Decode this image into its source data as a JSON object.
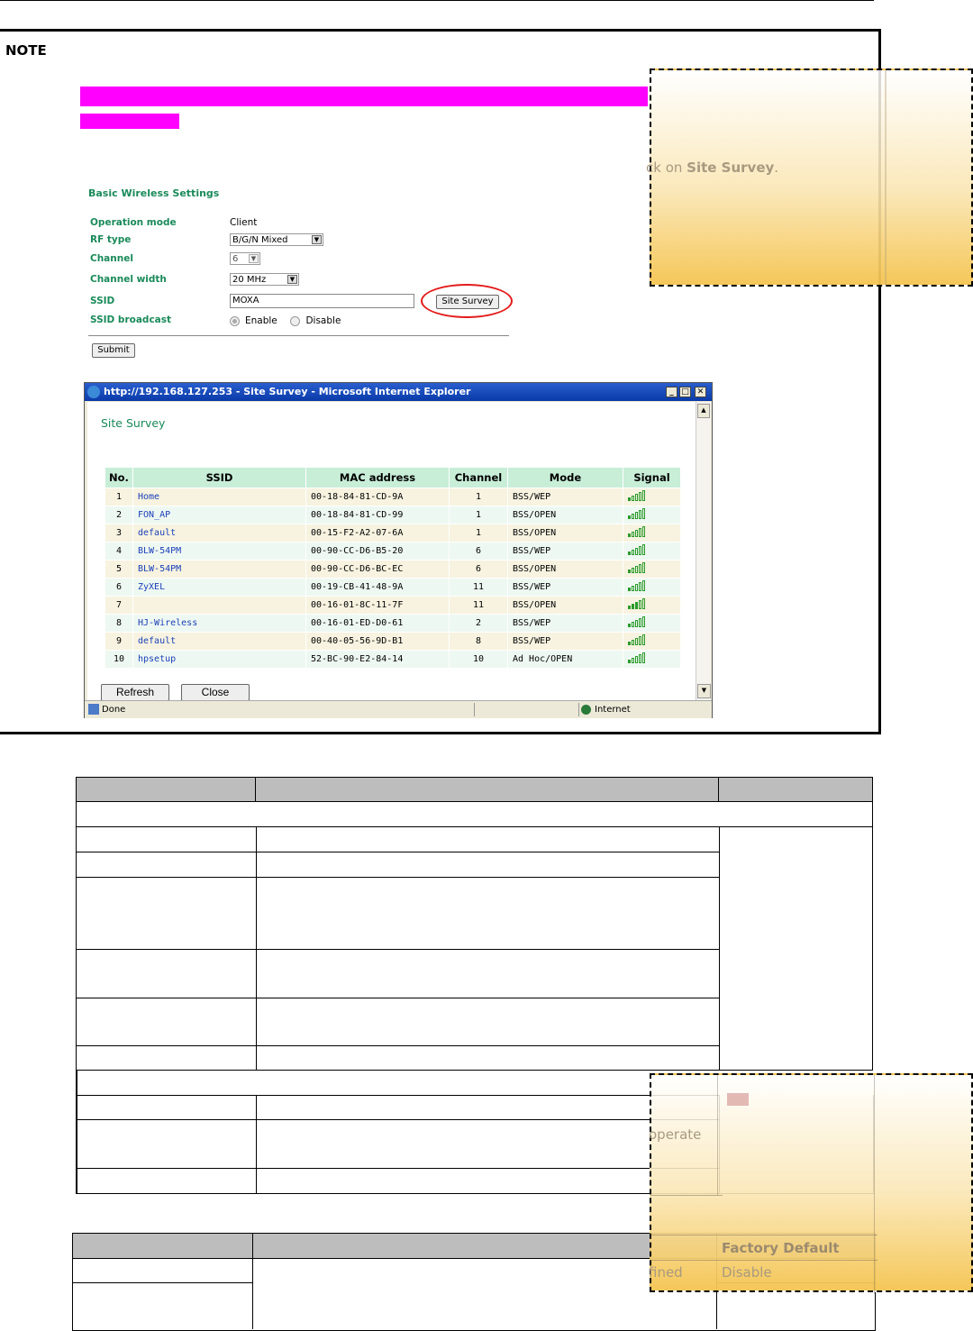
{
  "note": {
    "label": "NOTE"
  },
  "callout_top": {
    "text_prefix": "ck on ",
    "text_bold": "Site Survey",
    "text_suffix": "."
  },
  "basic_wireless": {
    "title": "Basic Wireless Settings",
    "rows": [
      {
        "label": "Operation mode",
        "value": "Client"
      },
      {
        "label": "RF type",
        "value": "B/G/N Mixed"
      },
      {
        "label": "Channel",
        "value": "6"
      },
      {
        "label": "Channel width",
        "value": "20 MHz"
      },
      {
        "label": "SSID",
        "value": "MOXA"
      },
      {
        "label": "SSID broadcast",
        "value": ""
      }
    ],
    "site_survey_button": "Site Survey",
    "radio_enable": "Enable",
    "radio_disable": "Disable",
    "submit_button": "Submit"
  },
  "ie_window": {
    "title": "http://192.168.127.253 - Site Survey - Microsoft Internet Explorer",
    "heading": "Site Survey",
    "columns": [
      "No.",
      "SSID",
      "MAC address",
      "Channel",
      "Mode",
      "Signal"
    ],
    "rows": [
      {
        "no": "1",
        "ssid": "Home",
        "mac": "00-18-84-81-CD-9A",
        "channel": "1",
        "mode": "BSS/WEP",
        "signal": 1
      },
      {
        "no": "2",
        "ssid": "FON_AP",
        "mac": "00-18-84-81-CD-99",
        "channel": "1",
        "mode": "BSS/OPEN",
        "signal": 1
      },
      {
        "no": "3",
        "ssid": "default",
        "mac": "00-15-F2-A2-07-6A",
        "channel": "1",
        "mode": "BSS/OPEN",
        "signal": 1
      },
      {
        "no": "4",
        "ssid": "BLW-54PM",
        "mac": "00-90-CC-D6-B5-20",
        "channel": "6",
        "mode": "BSS/WEP",
        "signal": 1
      },
      {
        "no": "5",
        "ssid": "BLW-54PM",
        "mac": "00-90-CC-D6-BC-EC",
        "channel": "6",
        "mode": "BSS/OPEN",
        "signal": 1
      },
      {
        "no": "6",
        "ssid": "ZyXEL",
        "mac": "00-19-CB-41-48-9A",
        "channel": "11",
        "mode": "BSS/WEP",
        "signal": 1
      },
      {
        "no": "7",
        "ssid": "",
        "mac": "00-16-01-8C-11-7F",
        "channel": "11",
        "mode": "BSS/OPEN",
        "signal": 3
      },
      {
        "no": "8",
        "ssid": "HJ-Wireless",
        "mac": "00-16-01-ED-D0-61",
        "channel": "2",
        "mode": "BSS/WEP",
        "signal": 1
      },
      {
        "no": "9",
        "ssid": "default",
        "mac": "00-40-05-56-9D-B1",
        "channel": "8",
        "mode": "BSS/WEP",
        "signal": 1
      },
      {
        "no": "10",
        "ssid": "hpsetup",
        "mac": "52-BC-90-E2-84-14",
        "channel": "10",
        "mode": "Ad Hoc/OPEN",
        "signal": 1
      }
    ],
    "refresh_button": "Refresh",
    "close_button": "Close",
    "status_left": "Done",
    "status_zone": "Internet"
  },
  "callout_bottom": {
    "ghost_text_1": "operate",
    "ghost_text_2": "fined"
  },
  "table2": {
    "factory_default_header": "Factory Default",
    "factory_default_value": "Disable"
  },
  "colors": {
    "magenta_highlight": "#ff00ff",
    "survey_ring": "#e41b1b",
    "green_label": "#1a8a5a"
  }
}
